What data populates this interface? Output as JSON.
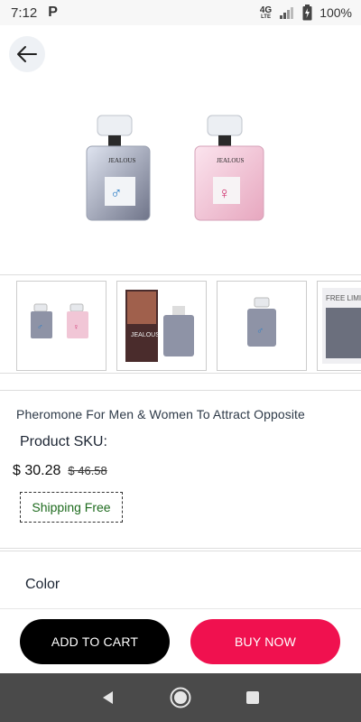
{
  "status_bar": {
    "time": "7:12",
    "notification_icon": "P",
    "network_label_top": "4G",
    "network_label_bottom": "LTE",
    "battery": "100%"
  },
  "icons": {
    "back": "arrow-left-icon",
    "nav_back": "triangle-back-icon",
    "nav_home": "circle-home-icon",
    "nav_recent": "square-recent-icon"
  },
  "product": {
    "brand_label": "JEALOUS",
    "title": "Pheromone For Men & Women To Attract Opposite",
    "sku_label": "Product SKU:",
    "price": "$ 30.28",
    "old_price": "$ 46.58",
    "shipping": "Shipping Free",
    "color_label": "Color",
    "thumb2_brand": "JEALOUS",
    "thumb4_brand": "FREE LIMITED"
  },
  "actions": {
    "add_to_cart": "ADD TO CART",
    "buy_now": "BUY NOW"
  },
  "colors": {
    "buy_now": "#f0114f",
    "add_to_cart": "#000000",
    "shipping_text": "#1e6b1e",
    "navbar": "#4a4a4a"
  }
}
